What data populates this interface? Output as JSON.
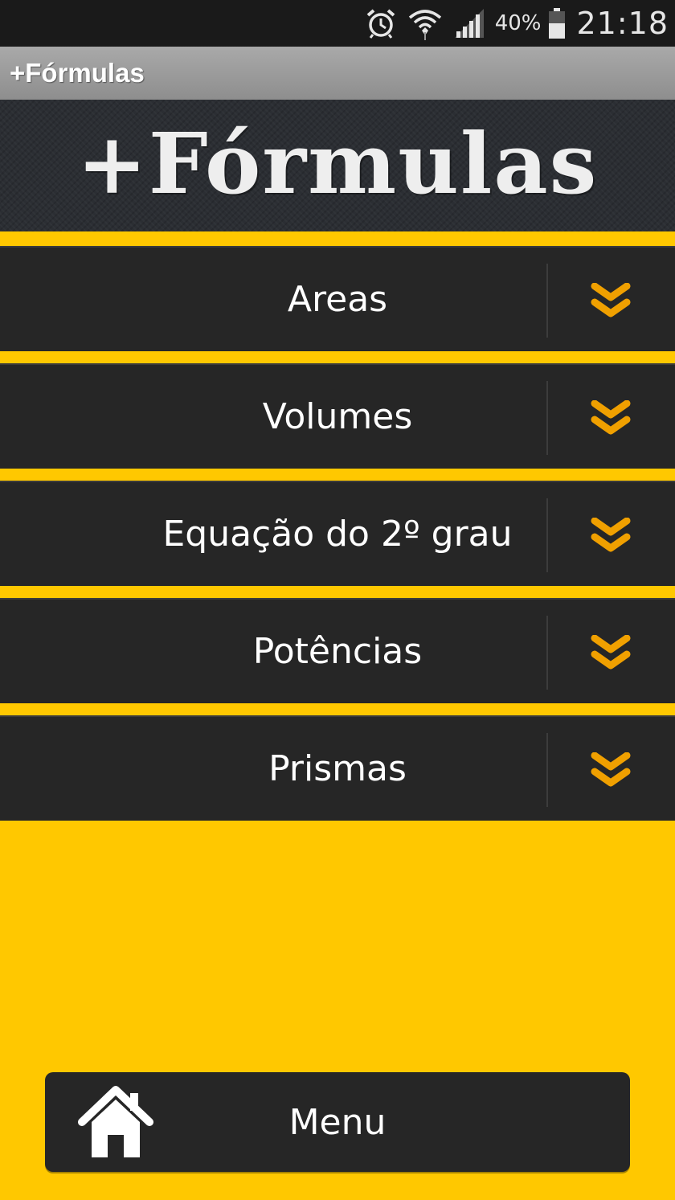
{
  "status_bar": {
    "battery_percent": "40%",
    "time": "21:18",
    "icons": [
      "alarm-icon",
      "wifi-icon",
      "signal-icon",
      "battery-icon"
    ]
  },
  "app": {
    "title": "+Fórmulas",
    "banner_logo": "+Fórmulas"
  },
  "accordion": {
    "items": [
      {
        "label": "Areas"
      },
      {
        "label": "Volumes"
      },
      {
        "label": "Equação do 2º grau"
      },
      {
        "label": "Potências"
      },
      {
        "label": "Prismas"
      }
    ],
    "expand_icon": "double-chevron-down-icon"
  },
  "menu": {
    "label": "Menu",
    "icon": "home-icon"
  },
  "colors": {
    "background": "#ffc800",
    "item_bg": "#262626",
    "chevron": "#f0a000",
    "status_bar": "#1a1a1a"
  }
}
